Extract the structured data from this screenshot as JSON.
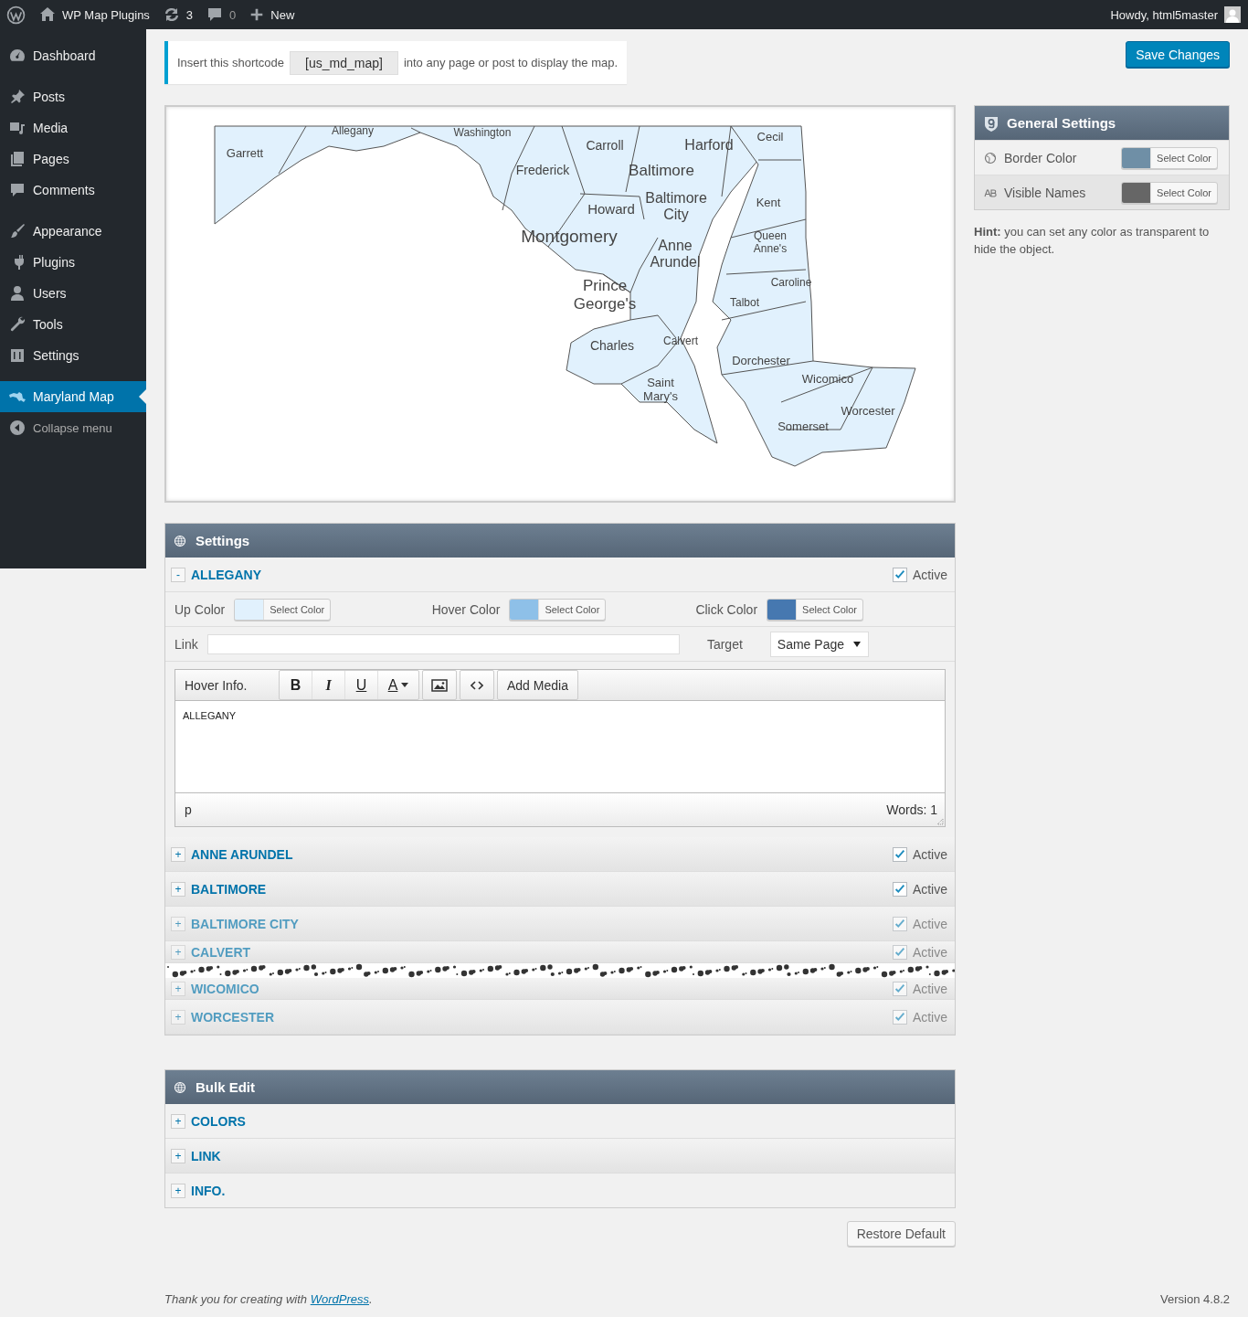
{
  "admin_bar": {
    "site_name": "WP Map Plugins",
    "updates": "3",
    "comments": "0",
    "new": "New",
    "greeting": "Howdy, html5master"
  },
  "sidebar": {
    "groups": [
      {
        "items": [
          {
            "label": "Dashboard",
            "selected": false
          }
        ]
      },
      {
        "items": [
          {
            "label": "Posts",
            "selected": false
          },
          {
            "label": "Media",
            "selected": false
          },
          {
            "label": "Pages",
            "selected": false
          },
          {
            "label": "Comments",
            "selected": false
          }
        ]
      },
      {
        "items": [
          {
            "label": "Appearance",
            "selected": false
          },
          {
            "label": "Plugins",
            "selected": false
          },
          {
            "label": "Users",
            "selected": false
          },
          {
            "label": "Tools",
            "selected": false
          },
          {
            "label": "Settings",
            "selected": false
          }
        ]
      },
      {
        "items": [
          {
            "label": "Maryland Map",
            "selected": true
          }
        ]
      }
    ],
    "collapse": "Collapse menu"
  },
  "shortcode_notice": {
    "before": "Insert this shortcode",
    "code": "[us_md_map]",
    "after": "into any page or post to display the map."
  },
  "save_button": "Save Changes",
  "map": {
    "labels": [
      "Garrett",
      "Allegany",
      "Washington",
      "Carroll",
      "Harford",
      "Cecil",
      "Frederick",
      "Baltimore",
      "Baltimore City",
      "Kent",
      "Howard",
      "Montgomery",
      "Anne Arundel",
      "Queen Anne's",
      "Caroline",
      "Prince George's",
      "Talbot",
      "Charles",
      "Calvert",
      "Dorchester",
      "Saint Mary's",
      "Wicomico",
      "Worcester",
      "Somerset"
    ]
  },
  "settings": {
    "title": "Settings",
    "regions": [
      {
        "name": "ALLEGANY",
        "toggle": "-",
        "expanded": true,
        "active": true,
        "active_label": "Active",
        "faded": false,
        "break_after": false,
        "details": {
          "colors": [
            {
              "label": "Up Color",
              "color": "#e1f1fd",
              "button": "Select Color"
            },
            {
              "label": "Hover Color",
              "color": "#8ec0e8",
              "button": "Select Color"
            },
            {
              "label": "Click Color",
              "color": "#4678b0",
              "button": "Select Color"
            }
          ],
          "link_label": "Link",
          "target_label": "Target",
          "target_value": "Same Page",
          "editor": {
            "label": "Hover Info.",
            "format_buttons": [
              "B",
              "I",
              "U",
              "A"
            ],
            "add_media": "Add Media",
            "content": "ALLEGANY",
            "path": "p",
            "word_count": "Words: 1"
          }
        }
      },
      {
        "name": "ANNE ARUNDEL",
        "toggle": "+",
        "expanded": false,
        "active": true,
        "active_label": "Active",
        "faded": false,
        "break_after": false
      },
      {
        "name": "BALTIMORE",
        "toggle": "+",
        "expanded": false,
        "active": true,
        "active_label": "Active",
        "faded": false,
        "break_after": false
      },
      {
        "name": "BALTIMORE CITY",
        "toggle": "+",
        "expanded": false,
        "active": true,
        "active_label": "Active",
        "faded": true,
        "break_after": false
      },
      {
        "name": "CALVERT",
        "toggle": "+",
        "expanded": false,
        "active": true,
        "active_label": "Active",
        "faded": true,
        "break_after": true
      },
      {
        "name": "WICOMICO",
        "toggle": "+",
        "expanded": false,
        "active": true,
        "active_label": "Active",
        "faded": true,
        "break_after": false
      },
      {
        "name": "WORCESTER",
        "toggle": "+",
        "expanded": false,
        "active": true,
        "active_label": "Active",
        "faded": true,
        "break_after": false
      }
    ]
  },
  "bulk_edit": {
    "title": "Bulk Edit",
    "items": [
      {
        "name": "COLORS",
        "toggle": "+"
      },
      {
        "name": "LINK",
        "toggle": "+"
      },
      {
        "name": "INFO.",
        "toggle": "+"
      }
    ]
  },
  "restore_button": "Restore Default",
  "general_settings": {
    "title": "General Settings",
    "rows": [
      {
        "label": "Border Color",
        "color": "#6f8fa6",
        "button": "Select Color"
      },
      {
        "label": "Visible Names",
        "color": "#666666",
        "button": "Select Color"
      }
    ]
  },
  "hint": "**Hint:** you can set any color as transparent to hide the object.",
  "footer": {
    "before": "Thank you for creating with",
    "link": "WordPress",
    "after": ".",
    "version": "Version 4.8.2"
  }
}
